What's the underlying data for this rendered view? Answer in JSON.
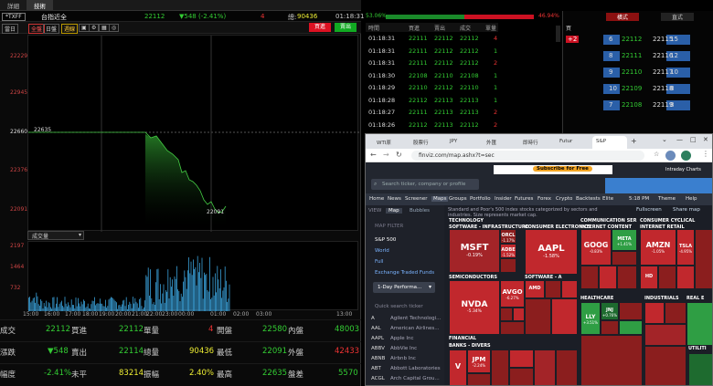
{
  "left": {
    "tabs": [
      "詳細",
      "技術"
    ],
    "quote": {
      "symbol": "*TXFF",
      "name": "台指近全",
      "price": "22112",
      "change": "▼548 (-2.41%)",
      "qty": "4",
      "total_label": "總:",
      "total": "90436",
      "time": "01:18:31"
    },
    "toolbar": {
      "period": "當日",
      "full": "全盤",
      "day": "日盤",
      "ticks": "週線",
      "buy": "買進",
      "sell": "賣出"
    },
    "price_axis": [
      "22229",
      "22945",
      "22660",
      "22376",
      "22091"
    ],
    "annot_high": "22635",
    "annot_low": "22091",
    "vol_select": "成交量",
    "vol_axis": [
      "2197",
      "1464",
      "732"
    ],
    "time_axis": [
      "15:00",
      "16:00",
      "17:00",
      "18:00",
      "19:00",
      "20:00",
      "21:00",
      "22:00",
      "23:00",
      "00:00",
      "01:00",
      "02:00",
      "03:00",
      "13:00"
    ],
    "stats": [
      [
        "成交",
        "22112",
        "買進",
        "22112",
        "單量",
        "4",
        "開盤",
        "22580",
        "內盤",
        "48003"
      ],
      [
        "漲跌",
        "▼548",
        "賣出",
        "22114",
        "總量",
        "90436",
        "最低",
        "22091",
        "外盤",
        "42433"
      ],
      [
        "幅度",
        "-2.41%",
        "未平",
        "83214",
        "振幅",
        "2.40%",
        "最高",
        "22635",
        "盤差",
        "5570"
      ]
    ]
  },
  "ratio": {
    "left": "53.06%",
    "right": "46.94%"
  },
  "ticks": {
    "headers": [
      "時間",
      "買進",
      "賣出",
      "成交",
      "單量"
    ],
    "rows": [
      [
        "01:18:31",
        "22111",
        "22112",
        "22112",
        "4"
      ],
      [
        "01:18:31",
        "22111",
        "22112",
        "22112",
        "1"
      ],
      [
        "01:18:31",
        "22111",
        "22112",
        "22112",
        "2"
      ],
      [
        "01:18:30",
        "22108",
        "22110",
        "22108",
        "1"
      ],
      [
        "01:18:29",
        "22110",
        "22112",
        "22110",
        "1"
      ],
      [
        "01:18:28",
        "22112",
        "22113",
        "22113",
        "1"
      ],
      [
        "01:18:27",
        "22111",
        "22113",
        "22113",
        "2"
      ],
      [
        "01:18:26",
        "22112",
        "22113",
        "22112",
        "2"
      ]
    ]
  },
  "orderbook": {
    "tabs": [
      "橫式",
      "直式"
    ],
    "buy_label": "買",
    "rows": [
      [
        "+2",
        "6",
        "22112",
        "22115",
        "15"
      ],
      [
        "",
        "8",
        "22111",
        "22116",
        "12"
      ],
      [
        "",
        "9",
        "22110",
        "22117",
        "10"
      ],
      [
        "",
        "10",
        "22109",
        "22118",
        "8"
      ],
      [
        "",
        "7",
        "22108",
        "22119",
        "8"
      ]
    ]
  },
  "browser": {
    "tabs": [
      "WTI原",
      "股票行",
      "JPY",
      "外匯",
      "即時行",
      "Futur",
      "S&P"
    ],
    "url": "finviz.com/map.ashx?t=sec",
    "search_placeholder": "Search ticker, company or profile",
    "ad": "Subscribe for Free",
    "intraday": "Intraday Charts",
    "nav": [
      "Home",
      "News",
      "Screener",
      "Maps",
      "Groups",
      "Portfolio",
      "Insider",
      "Futures",
      "Forex",
      "Crypto",
      "Backtests",
      "Elite"
    ],
    "time": "5:18 PM",
    "theme": "Theme",
    "help": "Help",
    "view_label": "VIEW",
    "map_btn": "Map",
    "bubbles_btn": "Bubbles",
    "fullscreen": "Fullscreen",
    "share": "Share map",
    "map_filter": "MAP FILTER",
    "filters": [
      "S&P 500",
      "World",
      "Full",
      "Exchange Traded Funds"
    ],
    "perf": "1-Day Performa...",
    "quick_search": "Quick search ticker",
    "list": [
      [
        "A",
        "Agilent Technologi..."
      ],
      [
        "AAL",
        "American Airlines..."
      ],
      [
        "AAPL",
        "Apple Inc"
      ],
      [
        "ABBV",
        "AbbVie Inc"
      ],
      [
        "ABNB",
        "Airbnb Inc"
      ],
      [
        "ABT",
        "Abbott Laboratories"
      ],
      [
        "ACGL",
        "Arch Capital Grou..."
      ]
    ],
    "desc": "Standard and Poor's 500 index stocks categorized by sectors and industries. Size represents market cap.",
    "sectors": [
      "TECHNOLOGY",
      "COMMUNICATION SER",
      "CONSUMER CYCLICAL",
      "HEALTHCARE",
      "INDUSTRIALS",
      "FINANCIAL",
      "UTILITI",
      "REAL E"
    ],
    "subs": [
      "SOFTWARE - INFRASTRUCTURE",
      "CONSUMER ELECTRONICS",
      "INTERNET CONTENT",
      "INTERNET RETAIL",
      "SEMICONDUCTORS",
      "SOFTWARE - A",
      "BANKS - DIVERS"
    ],
    "tiles": [
      {
        "t": "MSFT",
        "p": "-0.19%"
      },
      {
        "t": "ORCL",
        "p": "-1.17%"
      },
      {
        "t": "ADBE",
        "p": "-1.52%"
      },
      {
        "t": "AAPL",
        "p": "-1.58%"
      },
      {
        "t": "GOOG",
        "p": "-0.83%"
      },
      {
        "t": "META",
        "p": "+1.41%"
      },
      {
        "t": "AMZN",
        "p": "-1.05%"
      },
      {
        "t": "TSLA",
        "p": "-4.95%"
      },
      {
        "t": "NVDA",
        "p": "-5.34%"
      },
      {
        "t": "AVGO",
        "p": "-6.27%"
      },
      {
        "t": "AMD",
        "p": ""
      },
      {
        "t": "LLY",
        "p": "+3.51%"
      },
      {
        "t": "JNJ",
        "p": "+0.76%"
      },
      {
        "t": "V",
        "p": ""
      },
      {
        "t": "JPM",
        "p": "-2.24%"
      },
      {
        "t": "HD",
        "p": ""
      }
    ],
    "colors": {
      "dark_red": "#8b1e1e",
      "red": "#c1282d",
      "mid_red": "#a32428",
      "green": "#2f9e44",
      "dark_green": "#1e6b2f",
      "gray": "#3f4552"
    }
  }
}
